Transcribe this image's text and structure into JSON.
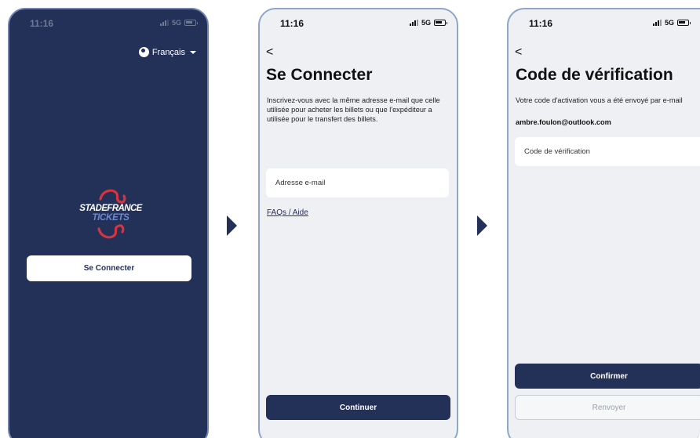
{
  "screens": {
    "welcome": {
      "time": "11:16",
      "network": "5G",
      "language": "Français",
      "logo": {
        "line1": "STADEFRANCE",
        "line2": "TICKETS"
      },
      "login_button": "Se Connecter"
    },
    "login": {
      "time": "11:16",
      "network": "5G",
      "back": "<",
      "title": "Se Connecter",
      "description": "Inscrivez-vous avec la même adresse e-mail que celle utilisée pour acheter les billets ou que l'expéditeur a utilisée pour le transfert des billets.",
      "email_placeholder": "Adresse e-mail",
      "faq_link": "FAQs / Aide",
      "continue_button": "Continuer"
    },
    "verification": {
      "time": "11:16",
      "network": "5G",
      "back": "<",
      "title": "Code de vérification",
      "description": "Votre code d'activation vous a été envoyé par e-mail",
      "email": "ambre.foulon@outlook.com",
      "code_placeholder": "Code de vérification",
      "confirm_button": "Confirmer",
      "resend_button": "Renvoyer"
    }
  },
  "colors": {
    "navy": "#233058",
    "accent_red": "#d6343f",
    "accent_blue": "#6b8ad1",
    "screen_bg": "#eff0f3"
  },
  "icons": [
    "globe-icon",
    "caret-down-icon",
    "signal-icon",
    "battery-icon",
    "back-chevron-icon",
    "flow-arrow-icon"
  ]
}
